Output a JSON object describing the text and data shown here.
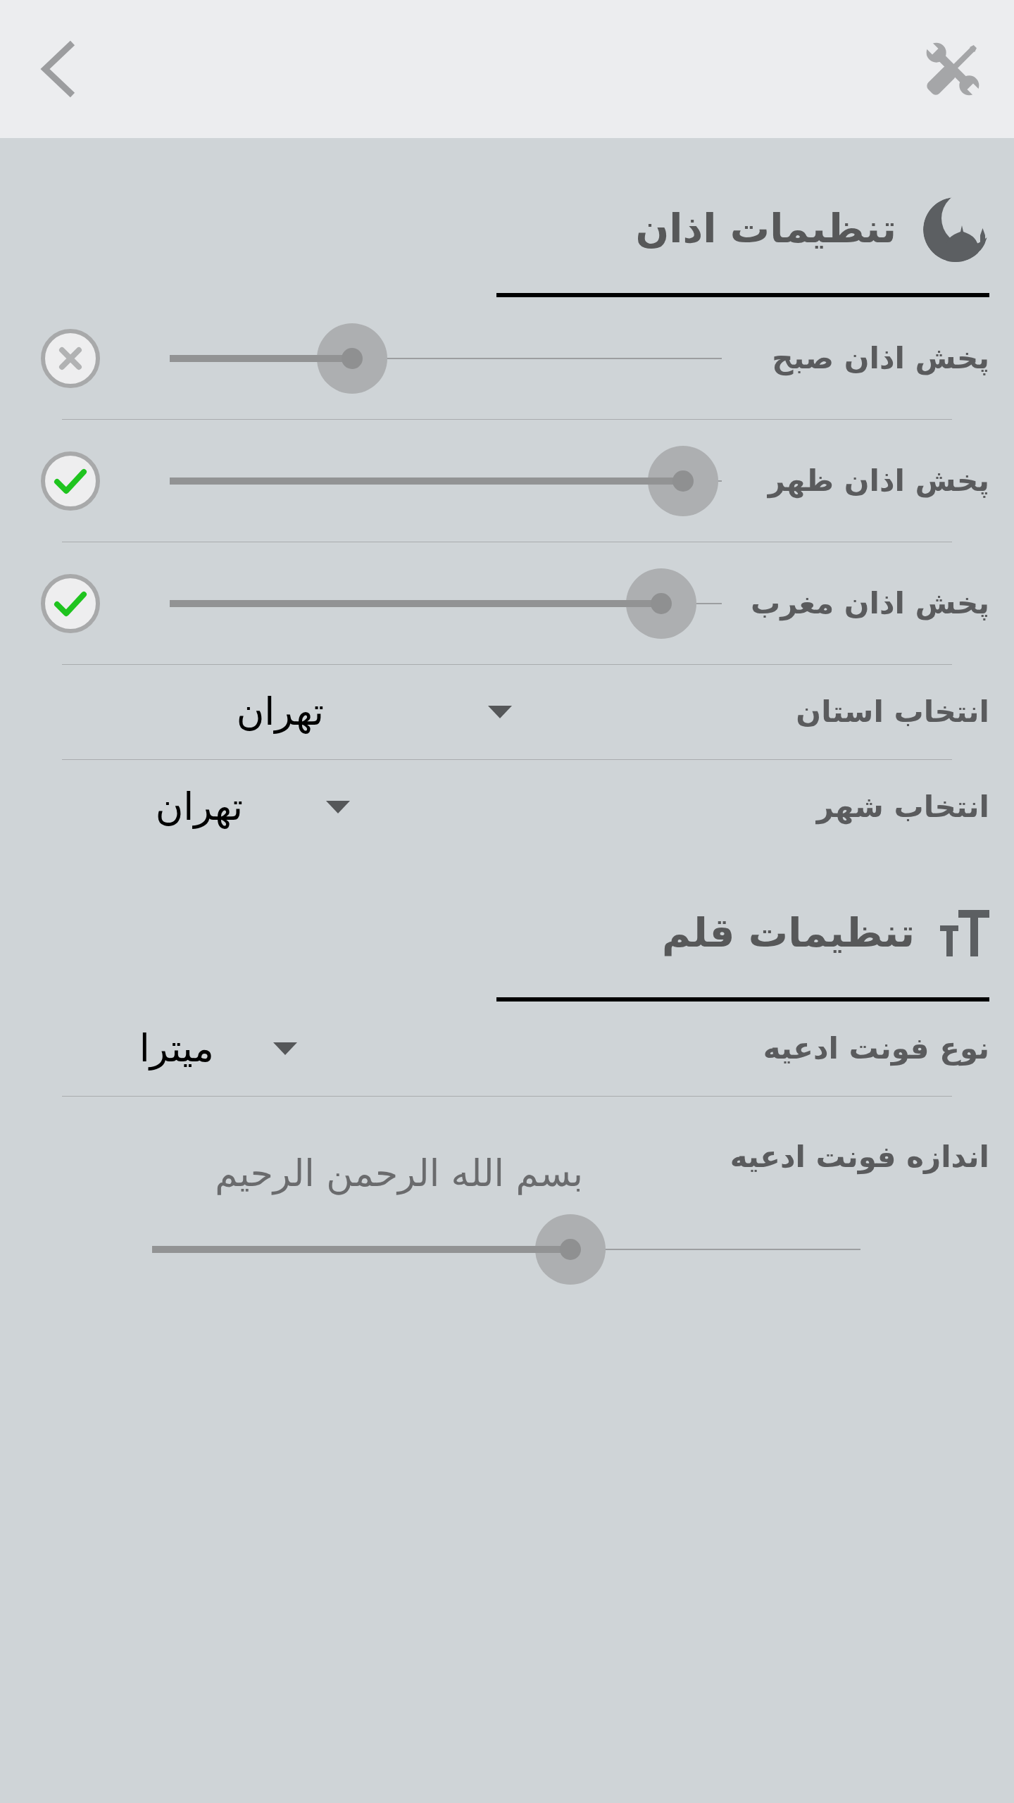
{
  "sections": [
    {
      "title": "تنظیمات اذان",
      "rows": [
        {
          "kind": "slider",
          "label": "پخش اذان صبح",
          "level": 0.33,
          "checked": false
        },
        {
          "kind": "slider",
          "label": "پخش اذان ظهر",
          "level": 0.93,
          "checked": true
        },
        {
          "kind": "slider",
          "label": "پخش اذان مغرب",
          "level": 0.89,
          "checked": true
        },
        {
          "kind": "dropdown",
          "label": "انتخاب استان",
          "value": "تهران"
        },
        {
          "kind": "dropdown",
          "label": "انتخاب شهر",
          "value": "تهران"
        }
      ]
    },
    {
      "title": "تنظیمات قلم",
      "rows": [
        {
          "kind": "dropdown",
          "label": "نوع فونت ادعیه",
          "value": "میترا"
        },
        {
          "kind": "size",
          "label": "اندازه فونت ادعیه",
          "preview": "بسم الله الرحمن الرحيم",
          "level": 0.59
        }
      ]
    }
  ]
}
